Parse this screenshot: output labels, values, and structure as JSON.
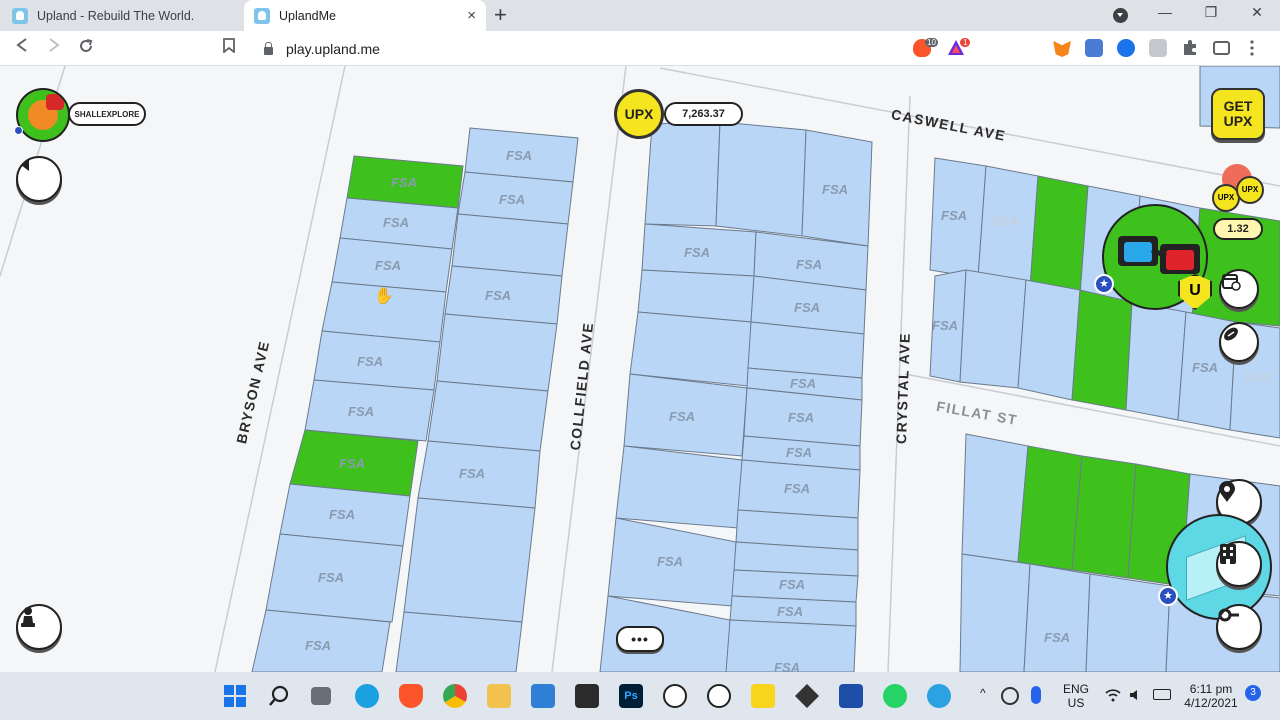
{
  "browser": {
    "tabs": [
      {
        "title": "Upland - Rebuild The World.",
        "active": false
      },
      {
        "title": "UplandMe",
        "active": true
      }
    ],
    "new_tab": "+",
    "close_glyph": "×",
    "window_controls": {
      "minimize": "—",
      "restore": "❐",
      "close": "✕"
    },
    "url": "play.upland.me",
    "extension_badges": {
      "brave": "10",
      "rewards": "1"
    }
  },
  "game": {
    "player": {
      "username": "SHALLEXPLORE"
    },
    "balance": {
      "currency": "UPX",
      "amount": "7,263.37"
    },
    "get_upx": {
      "line1": "GET",
      "line2": "UPX"
    },
    "multiplier": "1.32",
    "badge_letter": "U",
    "streets": {
      "caswell": "CASWELL AVE",
      "bryson": "BRYSON AVE",
      "collfield": "COLLFIELD AVE",
      "crystal": "CRYSTAL AVE",
      "fillat": "FILLAT ST"
    },
    "parcel_label": "FSA",
    "more_button": "•••",
    "colors": {
      "parcel_fsa": "#b9d6f7",
      "parcel_owned": "#3fc11d",
      "road": "#ffffff",
      "upx_coin": "#f5e51f"
    }
  },
  "taskbar": {
    "language": {
      "line1": "ENG",
      "line2": "US"
    },
    "time": "6:11 pm",
    "date": "4/12/2021",
    "notifications": "3"
  }
}
